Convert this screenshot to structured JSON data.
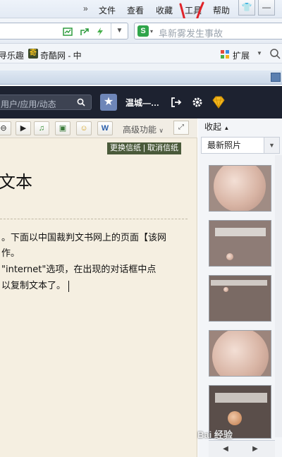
{
  "menu": {
    "items": [
      "文件",
      "查看",
      "收藏",
      "工具",
      "帮助"
    ],
    "overflow": "»",
    "shirt_label": "👕",
    "minimize_label": "—"
  },
  "search": {
    "placeholder": "阜新雾发生事故",
    "engine_glyph": "S"
  },
  "favorites": [
    {
      "label": "寻乐趣"
    },
    {
      "label": "奇酷网 - 中",
      "icon_glyph": "奇"
    }
  ],
  "extensions_label": "扩展",
  "app": {
    "search_placeholder": "用户/应用/动态",
    "user_name": "温城—…"
  },
  "editor": {
    "advanced_label": "高级功能",
    "stationery_change": "更换信纸",
    "stationery_separator": "|",
    "stationery_cancel": "取消信纸",
    "title": "文本",
    "lines": [
      "。下面以中国裁判文书网上的页面【该网",
      "作。",
      "\"internet\"选项，在出现的对话框中点",
      "以复制文本了。"
    ]
  },
  "panel": {
    "collapse_label": "收起",
    "collapse_glyph": "▲",
    "latest_label": "最新照片",
    "dropdown_glyph": "▼"
  },
  "watermark": "Bai 经验",
  "colors": {
    "header_bg": "#1d2230",
    "editor_bg": "#f5efe1",
    "accent_green": "#2fa54a",
    "annotation_red": "#e0242a"
  }
}
